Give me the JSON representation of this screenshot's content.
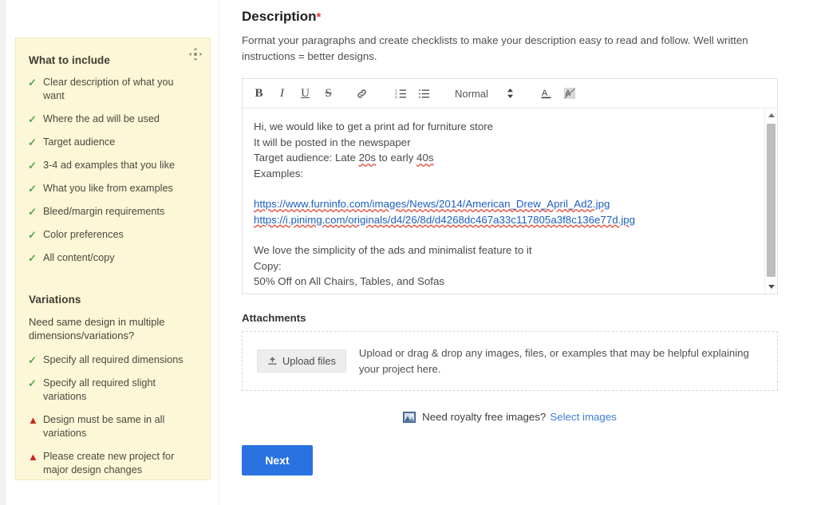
{
  "sidebar": {
    "drag_handle_icon": "move-icon",
    "include": {
      "heading": "What to include",
      "items": [
        {
          "mark": "check",
          "text": "Clear description of what you want"
        },
        {
          "mark": "check",
          "text": "Where the ad will be used"
        },
        {
          "mark": "check",
          "text": "Target audience"
        },
        {
          "mark": "check",
          "text": "3-4 ad examples that you like"
        },
        {
          "mark": "check",
          "text": "What you like from examples"
        },
        {
          "mark": "check",
          "text": "Bleed/margin requirements"
        },
        {
          "mark": "check",
          "text": "Color preferences"
        },
        {
          "mark": "check",
          "text": "All content/copy"
        }
      ]
    },
    "variations": {
      "heading": "Variations",
      "subtitle": "Need same design in multiple dimensions/variations?",
      "items": [
        {
          "mark": "check",
          "text": "Specify all required dimensions"
        },
        {
          "mark": "check",
          "text": "Specify all required slight variations"
        },
        {
          "mark": "warning",
          "text": "Design must be same in all variations"
        },
        {
          "mark": "warning",
          "text": "Please create new project for major design changes"
        }
      ]
    }
  },
  "main": {
    "section_title": "Description",
    "required_marker": "*",
    "section_description": "Format your paragraphs and create checklists to make your description easy to read and follow. Well written instructions = better designs.",
    "editor": {
      "toolbar": {
        "bold": "B",
        "italic": "I",
        "underline": "U",
        "strikethrough": "S",
        "link_icon": "link-icon",
        "ordered_list_icon": "ordered-list-icon",
        "bullet_list_icon": "bullet-list-icon",
        "format_select_value": "Normal",
        "stepper_icon": "stepper-up-down-icon",
        "text_color_icon": "text-color-icon",
        "clear_format_icon": "clear-formatting-icon"
      },
      "content": {
        "line1": "Hi, we would like to get a print ad for furniture store",
        "line2": "It will be posted in the newspaper",
        "line3_prefix": "Target audience: Late ",
        "line3_misspell1": "20s",
        "line3_middle": " to early ",
        "line3_misspell2": "40s",
        "line4": "Examples:",
        "link1": "https://www.furninfo.com/images/News/2014/American_Drew_April_Ad2.jpg",
        "link2": "https://i.pinimg.com/originals/d4/26/8d/d4268dc467a33c117805a3f8c136e77d.jpg",
        "line5": "We love the simplicity of the ads and minimalist feature to it",
        "line6": "Copy:",
        "line7": "50% Off on All Chairs, Tables, and Sofas"
      },
      "scrollbar": {
        "up_arrow_icon": "scroll-up-arrow-icon",
        "down_arrow_icon": "scroll-down-arrow-icon"
      }
    },
    "attachments": {
      "title": "Attachments",
      "upload_button_label": "Upload files",
      "upload_button_icon": "upload-icon",
      "hint": "Upload or drag & drop any images, files, or examples that may be helpful explaining your project here."
    },
    "royalty": {
      "icon": "image-icon",
      "text": "Need royalty free images?",
      "link_label": "Select images"
    },
    "next_button_label": "Next"
  },
  "colors": {
    "tips_background": "#fbf7d7",
    "check_green": "#5ca64a",
    "warning_red": "#d0241b",
    "link_blue": "#1b5fc1",
    "primary_button": "#2a72e0",
    "required_star": "#e23b2e"
  }
}
